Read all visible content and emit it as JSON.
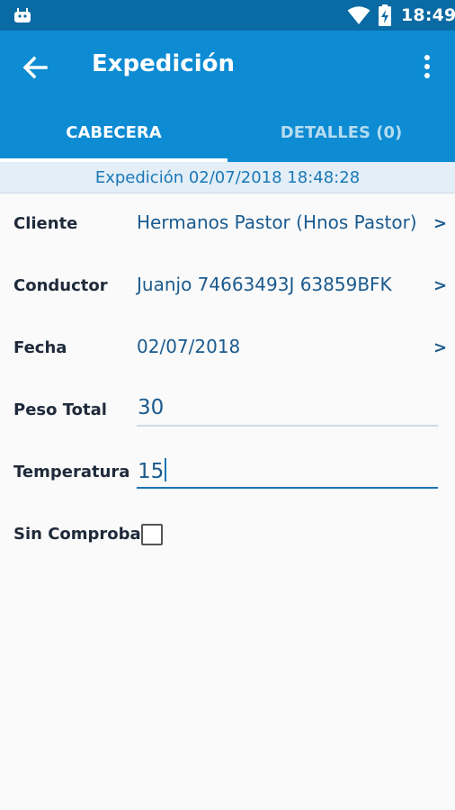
{
  "status_bar": {
    "time": "18:49",
    "icons": [
      "android-icon",
      "wifi-icon",
      "battery-charging-icon"
    ]
  },
  "app_bar": {
    "title": "Expedición",
    "back_icon": "arrow-back-icon",
    "menu_icon": "more-vert-icon"
  },
  "tabs": [
    {
      "label": "CABECERA",
      "active": true
    },
    {
      "label": "DETALLES (0)",
      "active": false
    }
  ],
  "subheader": "Expedición 02/07/2018 18:48:28",
  "fields": {
    "cliente": {
      "label": "Cliente",
      "value": "Hermanos Pastor (Hnos Pastor)",
      "chevron": ">"
    },
    "conductor": {
      "label": "Conductor",
      "value": "Juanjo 74663493J 63859BFK",
      "chevron": ">"
    },
    "fecha": {
      "label": "Fecha",
      "value": "02/07/2018",
      "chevron": ">"
    },
    "peso_total": {
      "label": "Peso Total",
      "value": "30"
    },
    "temperatura": {
      "label": "Temperatura",
      "value": "15"
    },
    "sin_comprobar": {
      "label": "Sin Comprobar",
      "checked": false
    }
  },
  "colors": {
    "status_bar": "#0a6aa3",
    "app_bar": "#0d8bd3",
    "accent": "#1c74b4",
    "value_text": "#1a5a8e"
  }
}
